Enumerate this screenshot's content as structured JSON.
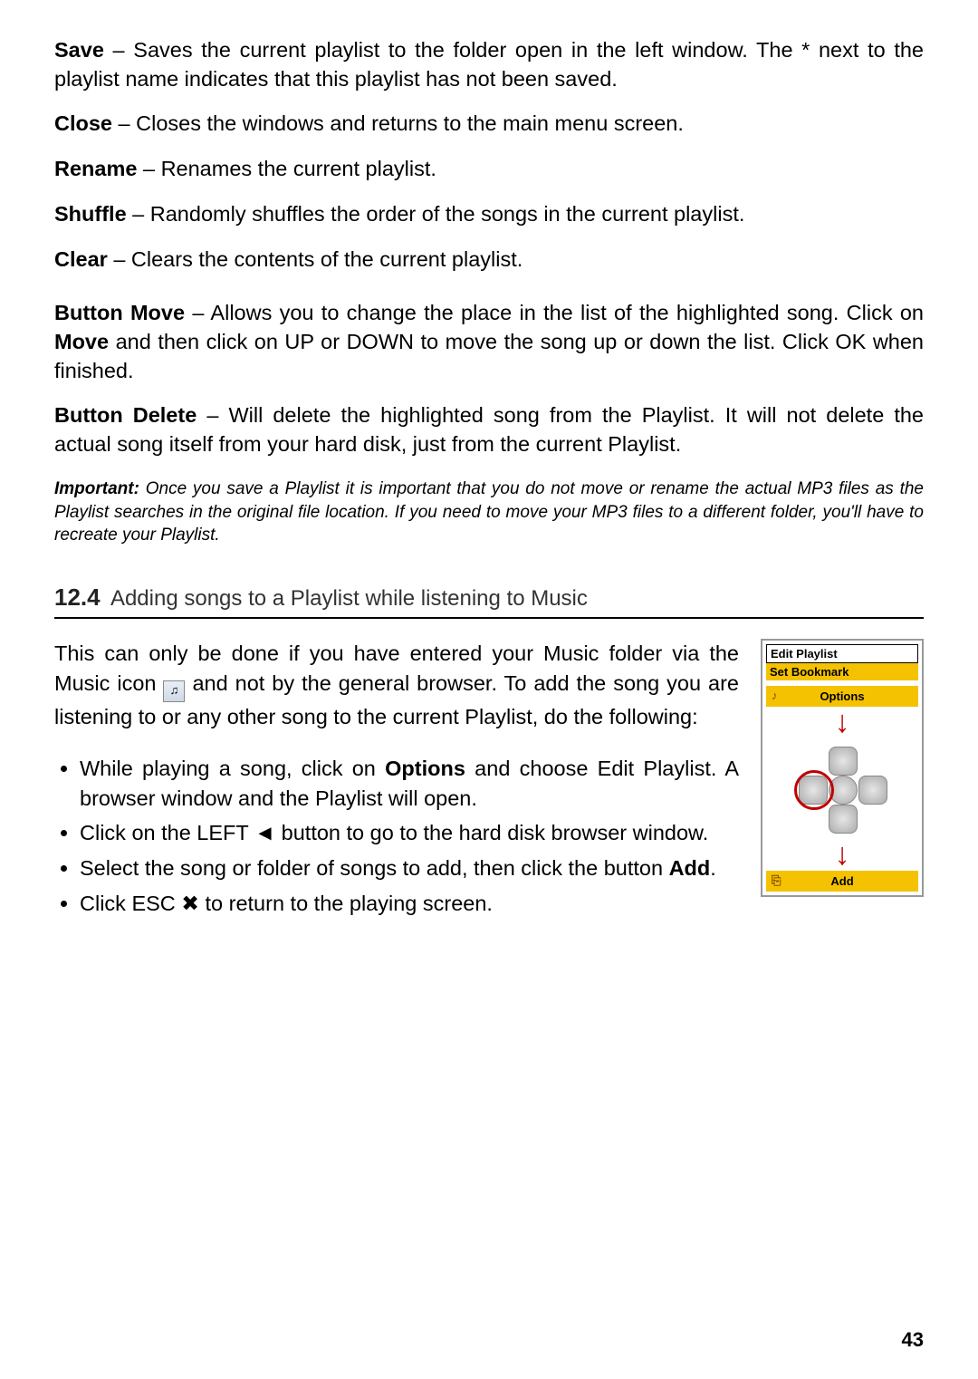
{
  "definitions": {
    "save": {
      "term": "Save",
      "text": " – Saves the current playlist to the folder open in the left window. The * next to the playlist name indicates that this playlist has not been saved."
    },
    "close": {
      "term": "Close",
      "text": " – Closes the windows and returns to the main menu screen."
    },
    "rename": {
      "term": "Rename",
      "text": " – Renames the current playlist."
    },
    "shuffle": {
      "term": "Shuffle",
      "text": " – Randomly shuffles the order of the songs in the current playlist."
    },
    "clear": {
      "term": "Clear",
      "text": " – Clears the contents of the current playlist."
    },
    "move": {
      "term": "Button Move",
      "text_a": " – Allows you to change the place in the list of the highlighted song. Click on ",
      "bold_mid": "Move",
      "text_b": " and then click on UP or DOWN to move the song up or down the list. Click OK when finished."
    },
    "delete": {
      "term": "Button Delete",
      "text": " – Will delete the highlighted song from the Playlist. It will not delete the actual song itself from your hard disk, just from the current Playlist."
    }
  },
  "important": {
    "label": "Important:",
    "text": " Once you save a Playlist it is important that you do not move or rename the actual MP3 files as the Playlist searches in the original file location. If you need to move your MP3 files to a different folder, you'll have to recreate your Playlist."
  },
  "section": {
    "number": "12.4",
    "title": "Adding songs to a Playlist while listening to Music"
  },
  "intro": {
    "a": "This can only be done if you have entered your Music folder via the Music icon ",
    "b": " and not by the general browser. To add the song you are listening to or any other song to the current Playlist, do the following:"
  },
  "steps": {
    "s1_a": "While playing a song, click on ",
    "s1_bold": "Options",
    "s1_b": " and choose Edit Playlist. A browser window and the Playlist will open.",
    "s2": "Click on the LEFT ◄ button to go to the hard disk browser window.",
    "s3_a": "Select the song or folder of songs to add, then click the button ",
    "s3_bold": "Add",
    "s3_b": ".",
    "s4": "Click ESC ✖ to return to the playing screen."
  },
  "figure": {
    "menu_title": "Edit Playlist",
    "menu_bookmark": "Set Bookmark",
    "options_btn": "Options",
    "options_icon": "♪",
    "add_btn": "Add",
    "add_icon": "⎘"
  },
  "page_number": "43"
}
